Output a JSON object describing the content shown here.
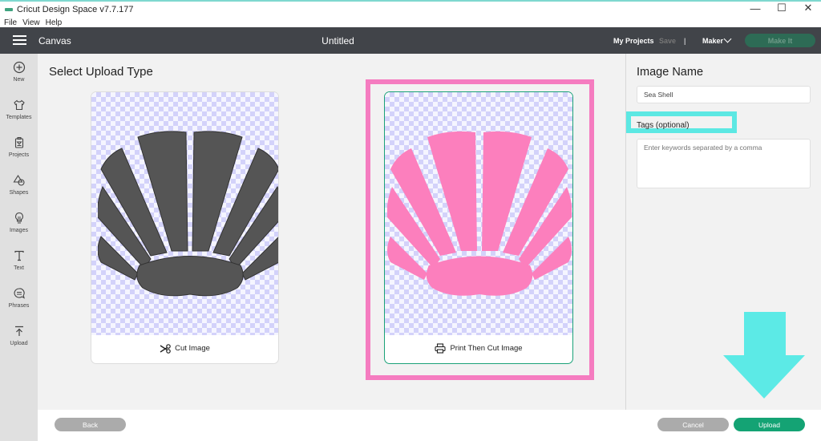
{
  "window": {
    "title": "Cricut Design Space  v7.7.177",
    "controls": {
      "minimize": "—",
      "maximize": "☐",
      "close": "✕"
    }
  },
  "menubar": {
    "items": [
      "File",
      "View",
      "Help"
    ]
  },
  "topbar": {
    "section": "Canvas",
    "doc_title": "Untitled",
    "my_projects": "My Projects",
    "save": "Save",
    "separator": "|",
    "machine": "Maker",
    "make_it": "Make It"
  },
  "sidebar": {
    "items": [
      {
        "label": "New",
        "icon": "plus-circle-icon"
      },
      {
        "label": "Templates",
        "icon": "shirt-icon"
      },
      {
        "label": "Projects",
        "icon": "projects-icon"
      },
      {
        "label": "Shapes",
        "icon": "shapes-icon"
      },
      {
        "label": "Images",
        "icon": "lightbulb-icon"
      },
      {
        "label": "Text",
        "icon": "text-icon"
      },
      {
        "label": "Phrases",
        "icon": "speech-bubble-icon"
      },
      {
        "label": "Upload",
        "icon": "upload-icon"
      }
    ]
  },
  "main": {
    "title": "Select Upload Type",
    "options": [
      {
        "label": "Cut Image",
        "icon": "scissors-icon",
        "shape_color": "#555555",
        "selected": false
      },
      {
        "label": "Print Then Cut Image",
        "icon": "printer-icon",
        "shape_color": "#fc7fbd",
        "selected": true
      }
    ]
  },
  "panel": {
    "title": "Image Name",
    "name_value": "Sea Shell",
    "tags_label": "Tags (optional)",
    "tags_placeholder": "Enter keywords separated by a comma"
  },
  "footer": {
    "back": "Back",
    "cancel": "Cancel",
    "upload": "Upload"
  },
  "annotations": {
    "highlight_pink": "#f57cc0",
    "highlight_cyan": "#5ce8e3"
  }
}
